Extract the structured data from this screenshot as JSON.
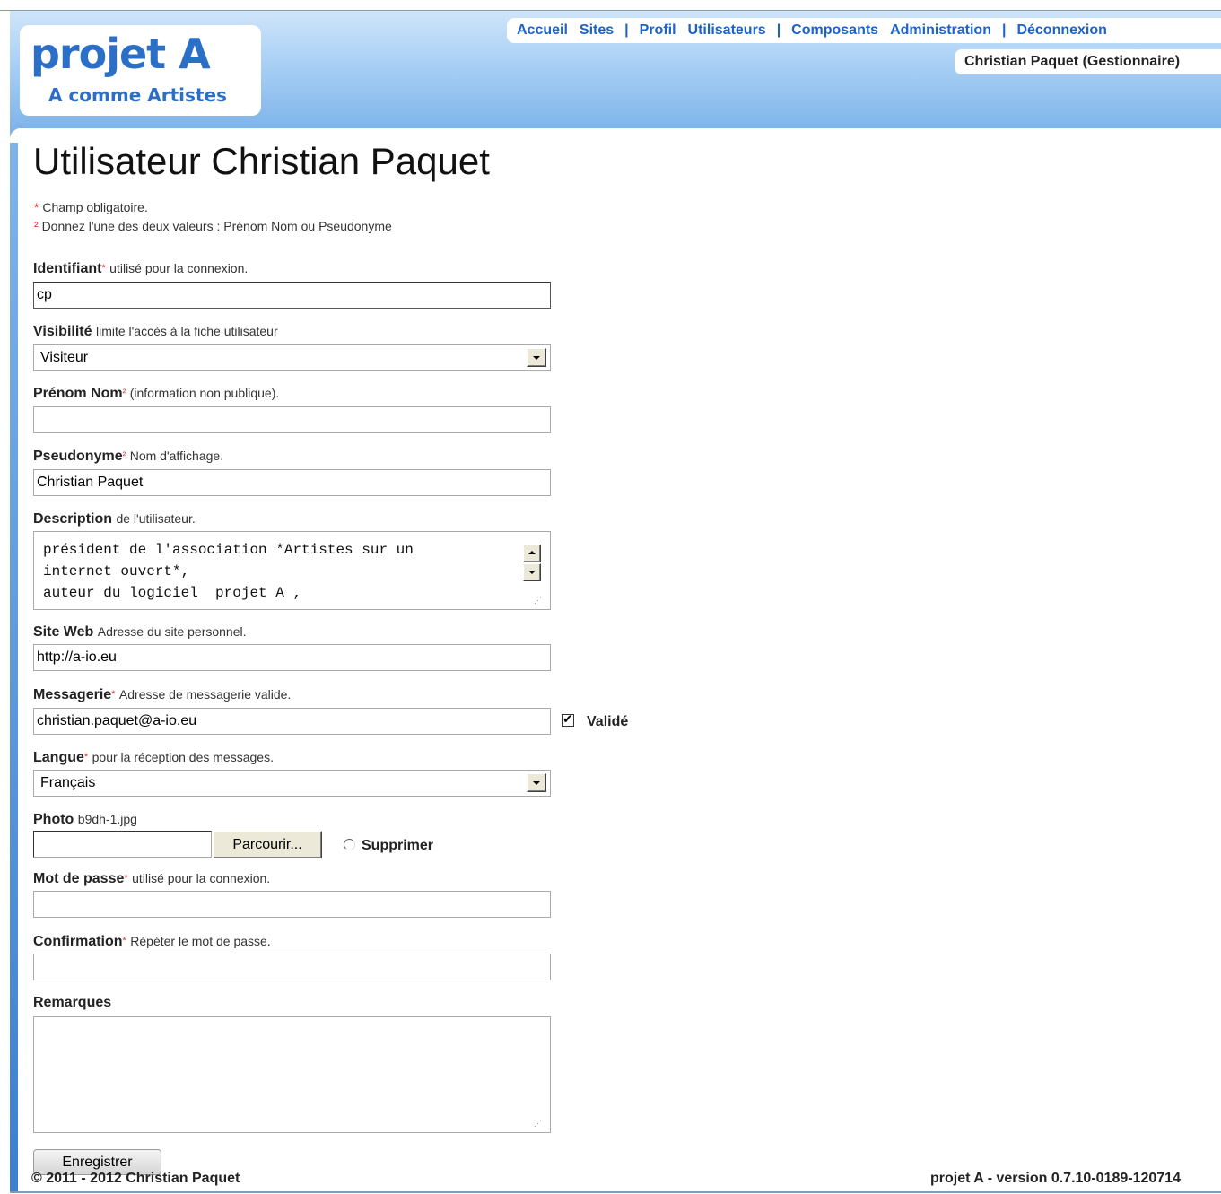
{
  "header": {
    "logo_title": "projet A",
    "logo_subtitle": "A comme Artistes",
    "nav": {
      "accueil": "Accueil",
      "sites": "Sites",
      "sep": "|",
      "profil": "Profil",
      "utilisateurs": "Utilisateurs",
      "composants": "Composants",
      "administration": "Administration",
      "deconnexion": "Déconnexion"
    },
    "current_user": "Christian Paquet (Gestionnaire)"
  },
  "page": {
    "title": "Utilisateur Christian Paquet",
    "note_required": "Champ obligatoire.",
    "note_either": "Donnez l'une des deux valeurs : Prénom Nom ou Pseudonyme",
    "star": "*",
    "star2": "²"
  },
  "form": {
    "identifiant": {
      "label": "Identifiant",
      "hint": "utilisé pour la connexion.",
      "value": "cp"
    },
    "visibilite": {
      "label": "Visibilité",
      "hint": "limite l'accès à la fiche utilisateur",
      "value": "Visiteur"
    },
    "prenom_nom": {
      "label": "Prénom Nom",
      "hint": "(information non publique).",
      "value": ""
    },
    "pseudonyme": {
      "label": "Pseudonyme",
      "hint": "Nom d'affichage.",
      "value": "Christian Paquet"
    },
    "description": {
      "label": "Description",
      "hint": "de l'utilisateur.",
      "value": "président de l'association *Artistes sur un\ninternet ouvert*,\nauteur du logiciel  projet A ,"
    },
    "site_web": {
      "label": "Site Web",
      "hint": "Adresse du site personnel.",
      "value": "http://a-io.eu"
    },
    "messagerie": {
      "label": "Messagerie",
      "hint": "Adresse de messagerie valide.",
      "value": "christian.paquet@a-io.eu",
      "valide_label": "Validé",
      "valide_checked": true
    },
    "langue": {
      "label": "Langue",
      "hint": "pour la réception des messages.",
      "value": "Français"
    },
    "photo": {
      "label": "Photo",
      "filename": "b9dh-1.jpg",
      "browse_label": "Parcourir...",
      "delete_label": "Supprimer"
    },
    "mot_de_passe": {
      "label": "Mot de passe",
      "hint": "utilisé pour la connexion.",
      "value": ""
    },
    "confirmation": {
      "label": "Confirmation",
      "hint": "Répéter le mot de passe.",
      "value": ""
    },
    "remarques": {
      "label": "Remarques",
      "value": ""
    },
    "save_label": "Enregistrer"
  },
  "footer": {
    "copyright": "© 2011 - 2012 Christian Paquet",
    "version": "projet A - version 0.7.10-0189-120714"
  },
  "colors": {
    "link": "#1b63c6",
    "required": "#d9322e",
    "header_gradient_top": "#cfe5fa",
    "header_gradient_bottom": "#7fb4ea"
  }
}
